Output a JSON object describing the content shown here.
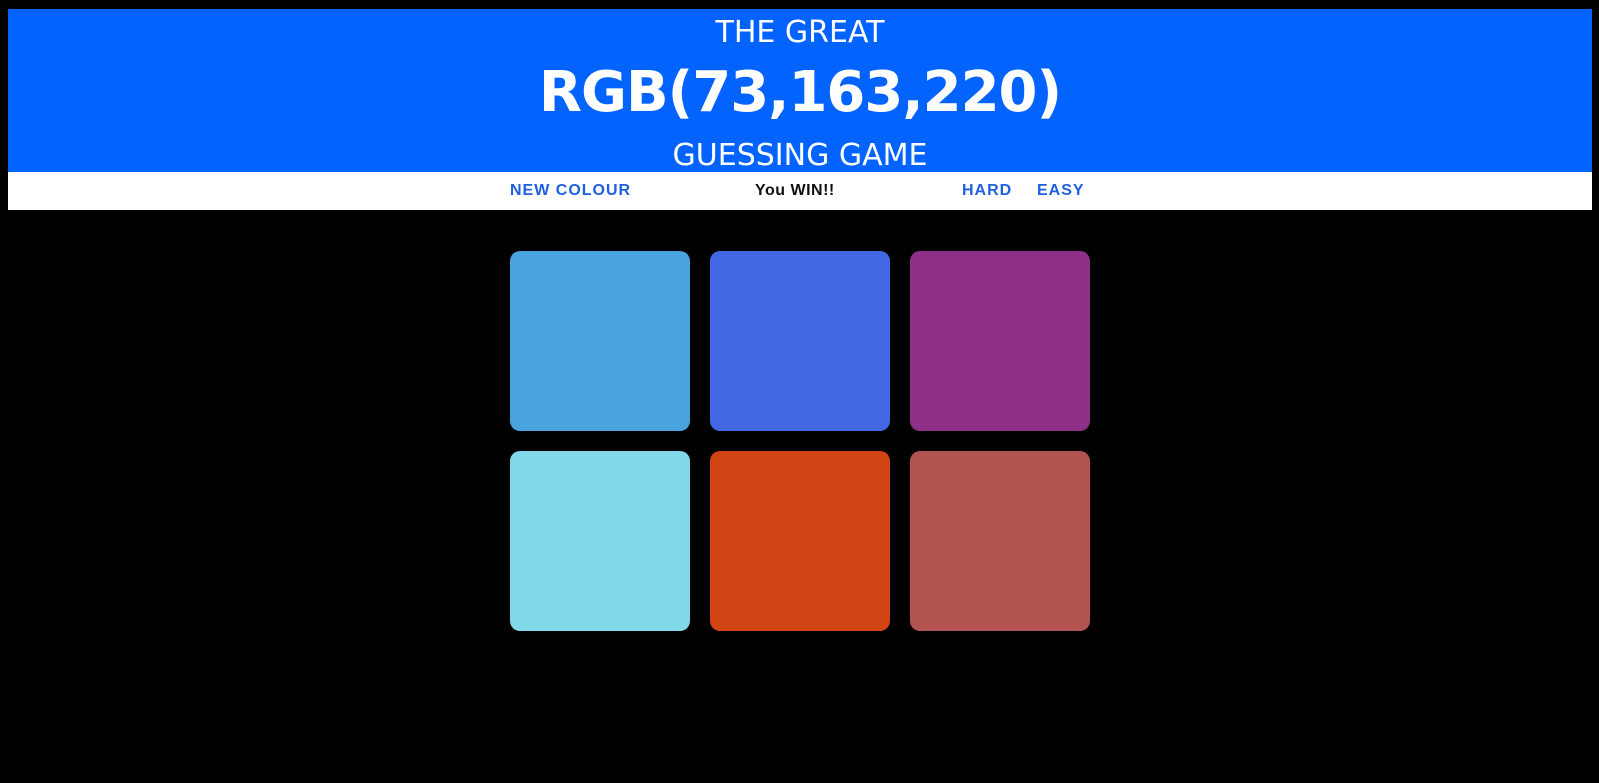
{
  "header": {
    "line1": "THE GREAT",
    "rgb_display": "RGB(73,163,220)",
    "line3": "GUESSING GAME",
    "background_color": "#0363ff"
  },
  "controls": {
    "new_colour_label": "NEW COLOUR",
    "message": "You WIN!!",
    "hard_label": "HARD",
    "easy_label": "EASY",
    "accent_color": "#1f5fe0"
  },
  "squares": [
    {
      "color": "#49a3dc"
    },
    {
      "color": "#4368e3"
    },
    {
      "color": "#8f3088"
    },
    {
      "color": "#80d8e8"
    },
    {
      "color": "#d24414"
    },
    {
      "color": "#b35452"
    }
  ]
}
